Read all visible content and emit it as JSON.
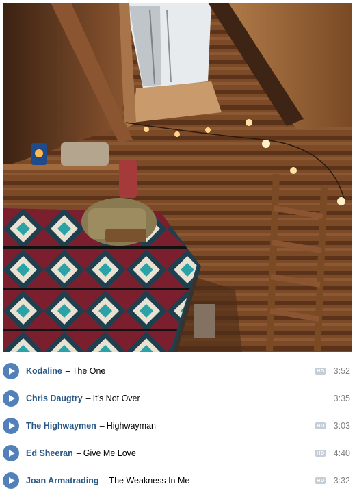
{
  "cover": {
    "icon": "cabin-interior-image"
  },
  "colors": {
    "accent": "#5181b8",
    "artist": "#2a5885",
    "muted": "#828282",
    "hd_badge": "#c5cdd7"
  },
  "hd_label": "HD",
  "tracks": [
    {
      "artist": "Kodaline",
      "separator": "–",
      "title": "The One",
      "hd": true,
      "duration": "3:52"
    },
    {
      "artist": "Chris Daugtry",
      "separator": "–",
      "title": "It's Not Over",
      "hd": false,
      "duration": "3:35"
    },
    {
      "artist": "The Highwaymen",
      "separator": "–",
      "title": "Highwayman",
      "hd": true,
      "duration": "3:03"
    },
    {
      "artist": "Ed Sheeran",
      "separator": "–",
      "title": "Give Me Love",
      "hd": true,
      "duration": "4:40"
    },
    {
      "artist": "Joan Armatrading",
      "separator": "–",
      "title": "The Weakness In Me",
      "hd": true,
      "duration": "3:32"
    }
  ]
}
